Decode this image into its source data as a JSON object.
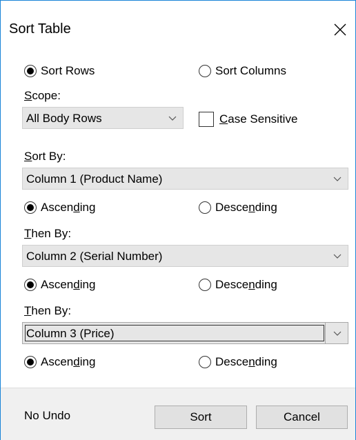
{
  "dialog": {
    "title": "Sort Table",
    "close_icon": "close-icon"
  },
  "orientation": {
    "sort_rows": {
      "label": "Sort Rows",
      "selected": true
    },
    "sort_columns": {
      "label": "Sort Columns",
      "selected": false
    }
  },
  "scope": {
    "label_prefix": "",
    "label_u": "S",
    "label_rest": "cope:",
    "value": "All Body Rows"
  },
  "case_sensitive": {
    "label_u": "C",
    "label_rest": "ase Sensitive",
    "checked": false
  },
  "sort_by": {
    "label_u": "S",
    "label_rest": "ort By:",
    "value": "Column 1 (Product Name)",
    "ascending": {
      "pre": "Ascen",
      "u": "d",
      "post": "ing",
      "selected": true
    },
    "descending": {
      "pre": "Desce",
      "u": "n",
      "post": "ding",
      "selected": false
    }
  },
  "then_by_1": {
    "label_u": "T",
    "label_rest": "hen By:",
    "value": "Column 2 (Serial Number)",
    "ascending": {
      "pre": "Ascen",
      "u": "d",
      "post": "ing",
      "selected": true
    },
    "descending": {
      "pre": "Desce",
      "u": "n",
      "post": "ding",
      "selected": false
    }
  },
  "then_by_2": {
    "label_u": "T",
    "label_rest": "hen By:",
    "value": "Column 3 (Price)",
    "ascending": {
      "pre": "Ascen",
      "u": "d",
      "post": "ing",
      "selected": true
    },
    "descending": {
      "pre": "Desce",
      "u": "n",
      "post": "ding",
      "selected": false
    }
  },
  "footer": {
    "no_undo": "No Undo",
    "sort_button": "Sort",
    "cancel_button": "Cancel"
  }
}
